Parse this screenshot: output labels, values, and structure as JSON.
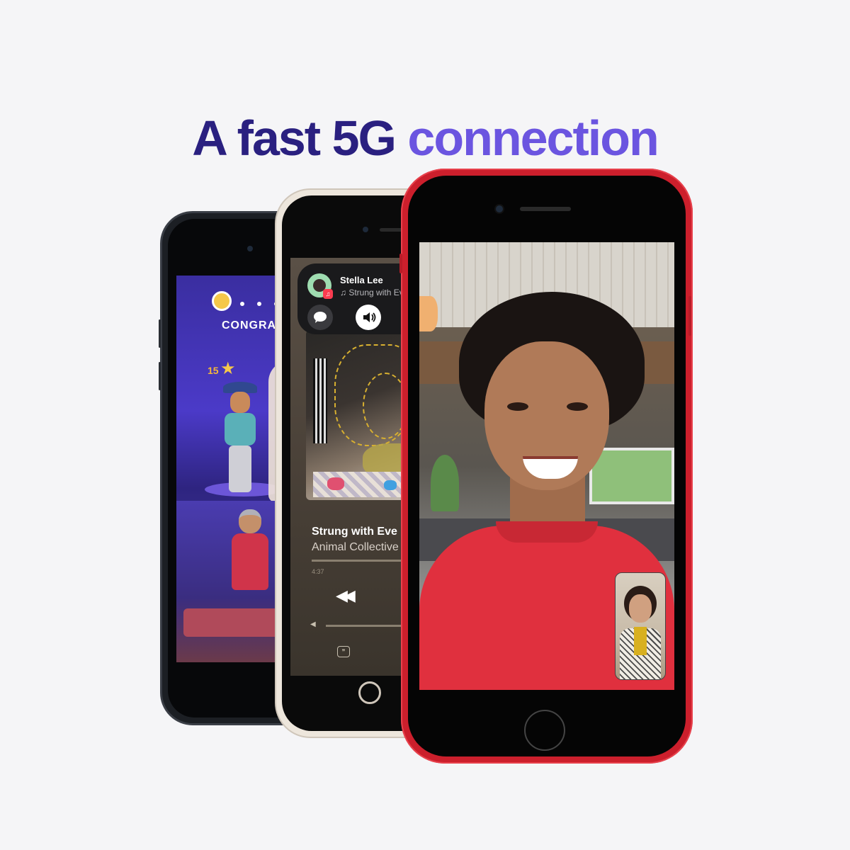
{
  "headline": {
    "part1": "A fast 5G",
    "part2": "connection",
    "color_part1": "#2a2080",
    "color_part2": "#6b55e0"
  },
  "phones": {
    "back": {
      "color": "midnight"
    },
    "middle": {
      "color": "starlight"
    },
    "front": {
      "color": "red",
      "hex": "#cc1f2c"
    }
  },
  "game_screen": {
    "banner": "CONGRA",
    "score": "15"
  },
  "shareplay_card": {
    "name": "Stella Lee",
    "subtitle": "♫ Strung with Eve",
    "icons": [
      "message-icon",
      "speaker-icon"
    ]
  },
  "now_playing": {
    "song_title": "Strung with Eve",
    "artist": "Animal Collective",
    "elapsed": "4:37"
  },
  "facetime": {
    "icons": [
      "self-view-pip"
    ]
  }
}
